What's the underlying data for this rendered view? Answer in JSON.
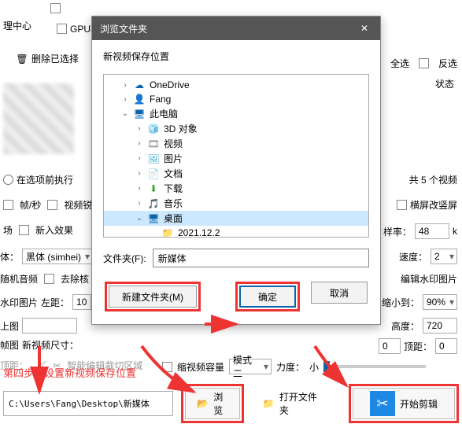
{
  "bg": {
    "mgmt": "理中心",
    "gpu": "GPU功",
    "del_sel": "删除已选择",
    "select_all": "全选",
    "invert": "反选",
    "status": "状态",
    "run_before": "在选项前执行",
    "count": "共 5 个视频",
    "fps": "帧/秒",
    "sharpen": "视频锐",
    "portrait": "横屏改竖屏",
    "scene": "场",
    "new_effect": "新入效果",
    "sample_lbl": "样率：",
    "sample_val": "48",
    "k": "k",
    "font_lbl": "体：",
    "font_val": "黑体 (simhei)",
    "speed_lbl": "速度：",
    "speed_val": "2",
    "rand_audio": "随机音频",
    "remove": "去除核",
    "edit_wm": "编辑水印图片",
    "wm_img": "水印图片",
    "left_lbl": "左距：",
    "left_val": "10",
    "file_lbl": "文件夹(F):",
    "shrink_lbl": "缩小到：",
    "shrink_val": "90%",
    "up_img": "上图",
    "height_lbl": "高度：",
    "height_val": "720",
    "frame_img": "帧图",
    "new_dim": "新视频尺寸：",
    "top_val": "0",
    "top_lbl": "顶距：",
    "top2_lbl": "顶距：",
    "smart_crop": "智能编辑裁切区域",
    "shrink_vid": "缩视频容量",
    "mode_val": "模式二",
    "strength": "力度：",
    "small": "小"
  },
  "dialog": {
    "title": "浏览文件夹",
    "subtitle": "新视频保存位置",
    "folder_val": "新媒体",
    "new_folder": "新建文件夹(M)",
    "ok": "确定",
    "cancel": "取消",
    "tree": [
      {
        "indent": 1,
        "caret": "›",
        "icon": "☁",
        "color": "#0a64ad",
        "label": "OneDrive"
      },
      {
        "indent": 1,
        "caret": "›",
        "icon": "👤",
        "color": "#2a8",
        "label": "Fang"
      },
      {
        "indent": 1,
        "caret": "⌄",
        "icon": "🖥",
        "color": "#0a64ad",
        "label": "此电脑"
      },
      {
        "indent": 2,
        "caret": "›",
        "icon": "🧊",
        "color": "#4ac",
        "label": "3D 对象"
      },
      {
        "indent": 2,
        "caret": "›",
        "icon": "🎞",
        "color": "#888",
        "label": "视频"
      },
      {
        "indent": 2,
        "caret": "›",
        "icon": "🖼",
        "color": "#4ac",
        "label": "图片"
      },
      {
        "indent": 2,
        "caret": "›",
        "icon": "📄",
        "color": "#4ac",
        "label": "文档"
      },
      {
        "indent": 2,
        "caret": "›",
        "icon": "⬇",
        "color": "#3a3",
        "label": "下载"
      },
      {
        "indent": 2,
        "caret": "›",
        "icon": "🎵",
        "color": "#d90",
        "label": "音乐"
      },
      {
        "indent": 2,
        "caret": "⌄",
        "icon": "🖥",
        "color": "#0a64ad",
        "label": "桌面",
        "sel": true
      },
      {
        "indent": 3,
        "caret": "",
        "icon": "📁",
        "color": "#e8b84a",
        "label": "2021.12.2"
      }
    ]
  },
  "step4": "第四步：设置新视频保存位置",
  "bottom": {
    "path": "C:\\Users\\Fang\\Desktop\\新媒体",
    "browse": "浏览",
    "open_folder": "打开文件夹",
    "start": "开始剪辑"
  }
}
